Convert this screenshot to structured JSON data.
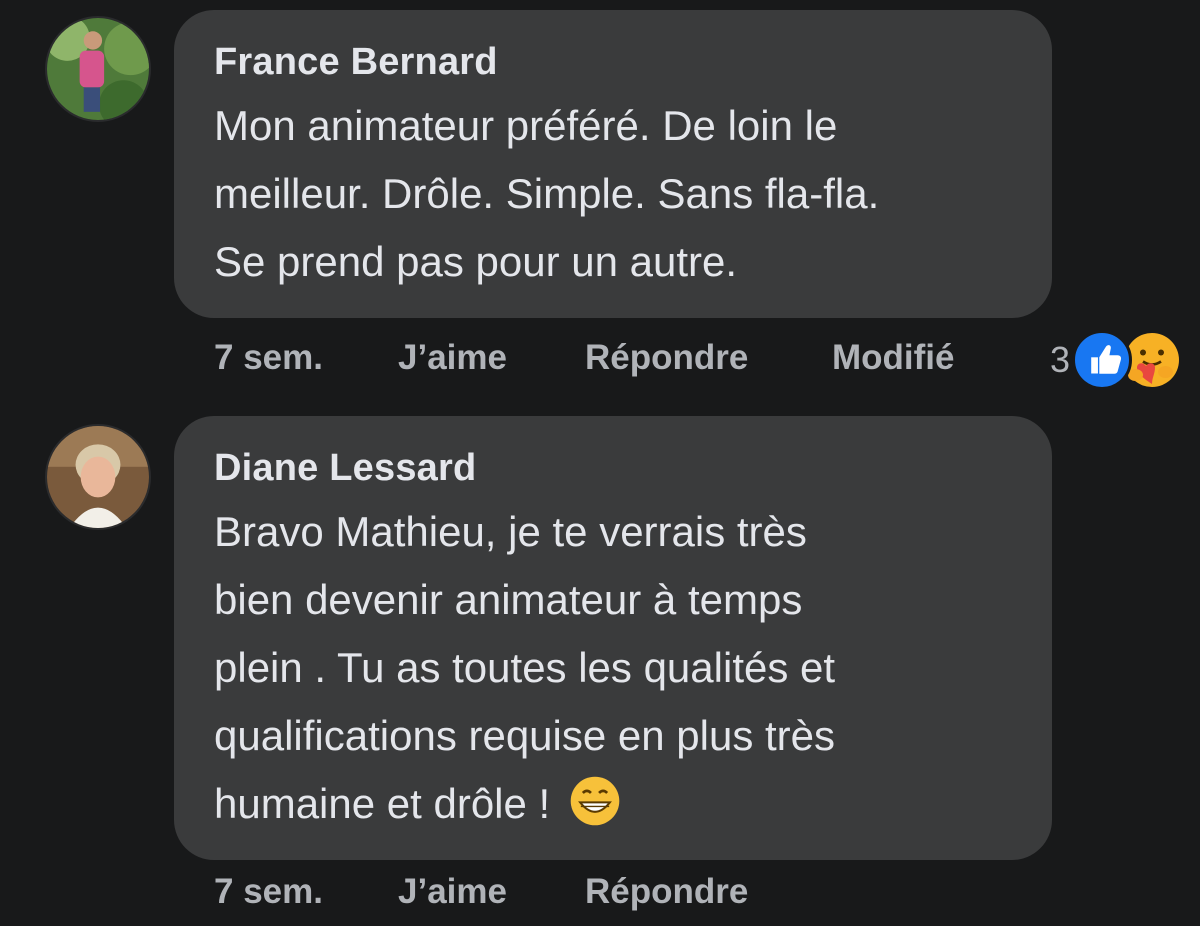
{
  "comments": [
    {
      "author": "France Bernard",
      "text_lines": [
        "Mon animateur préféré. De loin le",
        "meilleur. Drôle. Simple. Sans fla-fla.",
        "Se prend pas pour un autre."
      ],
      "time": "7 sem.",
      "like_label": "J’aime",
      "reply_label": "Répondre",
      "edited_label": "Modifié",
      "reaction_count": "3",
      "reaction_icons": [
        "like-icon",
        "care-icon"
      ]
    },
    {
      "author": "Diane Lessard",
      "text_lines": [
        "Bravo Mathieu, je te verrais très",
        "bien devenir animateur à temps",
        "plein . Tu as toutes les qualités et",
        "qualifications requise en plus très",
        "humaine et drôle ! "
      ],
      "emoji": "grinning-face-icon",
      "time": "7 sem.",
      "like_label": "J’aime",
      "reply_label": "Répondre"
    }
  ],
  "colors": {
    "background": "#18191a",
    "bubble": "#3a3b3c",
    "primary_text": "#e4e6eb",
    "secondary_text": "#b0b3b8",
    "like_blue": "#1877f2"
  }
}
